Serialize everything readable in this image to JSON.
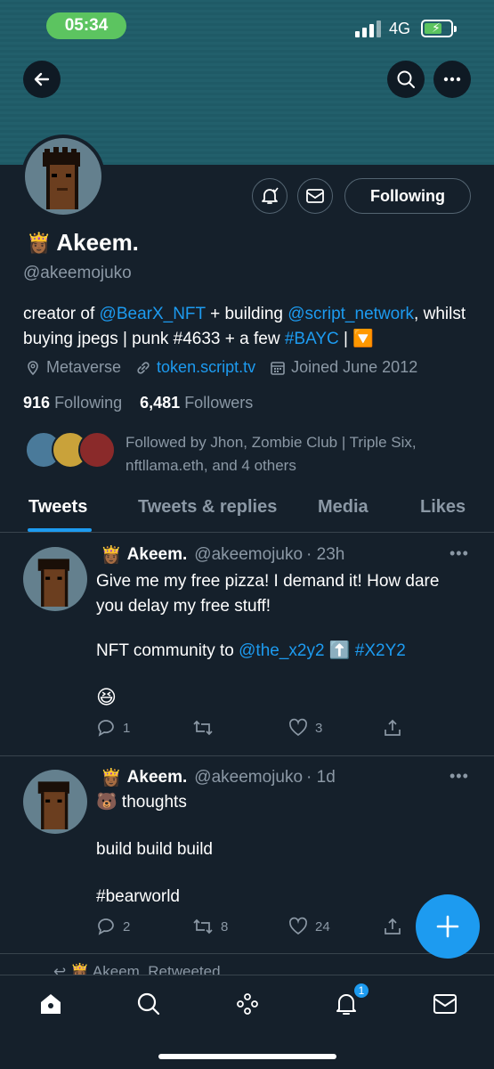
{
  "status": {
    "time": "05:34",
    "network": "4G"
  },
  "profile": {
    "name": "Akeem.",
    "name_emoji": "👸🏾",
    "handle": "@akeemojuko",
    "bio_parts": [
      {
        "t": "creator of "
      },
      {
        "t": "@BearX_NFT",
        "link": true
      },
      {
        "t": " + building "
      },
      {
        "t": "@script_network",
        "link": true
      },
      {
        "t": ","
      },
      {
        "t": " whilst buying jpegs | punk #4633 + a few "
      },
      {
        "t": "#BAYC",
        "link": true
      },
      {
        "t": " | 🔽"
      }
    ],
    "location": "Metaverse",
    "website": "token.script.tv",
    "joined": "Joined June 2012",
    "following_count": "916",
    "following_label": "Following",
    "followers_count": "6,481",
    "followers_label": "Followers",
    "followed_by": "Followed by Jhon, Zombie Club | Triple Six, nftllama.eth, and 4 others",
    "following_button": "Following"
  },
  "tabs": [
    "Tweets",
    "Tweets & replies",
    "Media",
    "Likes"
  ],
  "tweets": [
    {
      "emoji": "👸🏾",
      "name": "Akeem.",
      "handle": "@akeemojuko",
      "time": "· 23h",
      "line1": "Give me my free pizza! I demand it! How dare you delay my free stuff!",
      "line2_prefix": "NFT community to ",
      "line2_mention": "@the_x2y2",
      "line2_mid": " ⬆️ ",
      "line2_tag": "#X2Y2",
      "line3": "😆",
      "replies": "1",
      "retweets": "",
      "likes": "3"
    },
    {
      "emoji": "👸🏾",
      "name": "Akeem.",
      "handle": "@akeemojuko",
      "time": "· 1d",
      "line1": "🐻 thoughts",
      "line2": "build build build",
      "line3": "#bearworld",
      "replies": "2",
      "retweets": "8",
      "likes": "24"
    }
  ],
  "peek_text": "↩ 👸🏾 Akeem. Retweeted",
  "nav": {
    "notification_count": "1"
  },
  "colors": {
    "accent": "#1d9bf0",
    "bg": "#15202b",
    "muted": "#8b98a5"
  },
  "icons": [
    "back-arrow-icon",
    "search-icon",
    "more-icon",
    "bell-icon",
    "mail-icon",
    "location-icon",
    "link-icon",
    "calendar-icon",
    "reply-icon",
    "retweet-icon",
    "like-icon",
    "share-icon",
    "compose-icon",
    "home-icon",
    "spaces-icon",
    "notifications-icon",
    "messages-icon"
  ]
}
